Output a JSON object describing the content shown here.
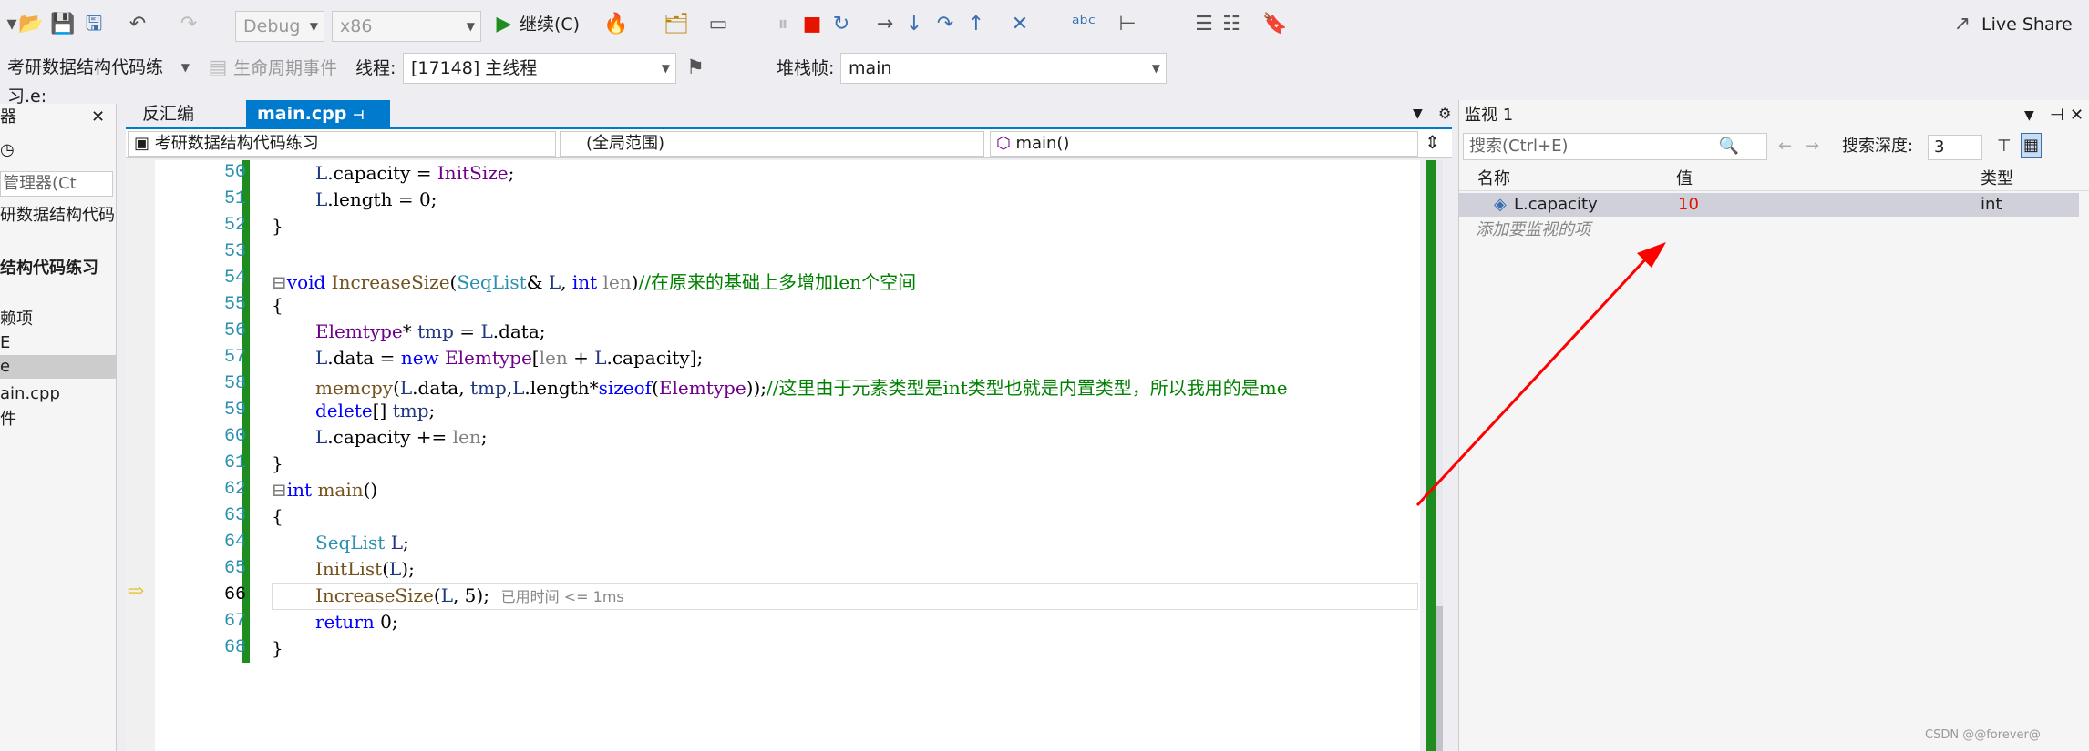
{
  "toolbar": {
    "config": "Debug",
    "platform": "x86",
    "continue": "继续(C)",
    "live_share": "Live Share"
  },
  "toolbar2": {
    "project": "考研数据结构代码练习.e:",
    "lifecycle": "生命周期事件",
    "thread_label": "线程:",
    "thread_value": "[17148] 主线程",
    "stack_label": "堆栈帧:",
    "stack_value": "main"
  },
  "left_panel": {
    "title": "器",
    "search": "管理器(Ct",
    "items": [
      "研数据结构代码练",
      "结构代码练习",
      "赖项",
      "E",
      "e",
      "ain.cpp",
      "件"
    ]
  },
  "tabs": {
    "disasm": "反汇编",
    "main": "main.cpp"
  },
  "navbar": {
    "project": "考研数据结构代码练习",
    "scope": "(全局范围)",
    "func": "main()"
  },
  "code": {
    "lines": [
      50,
      51,
      52,
      53,
      54,
      55,
      56,
      57,
      58,
      59,
      60,
      61,
      62,
      63,
      64,
      65,
      66,
      67,
      68
    ],
    "elapsed": "已用时间 <= 1ms"
  },
  "watch": {
    "title": "监视 1",
    "search": "搜索(Ctrl+E)",
    "depth_label": "搜索深度:",
    "depth_value": "3",
    "col_name": "名称",
    "col_value": "值",
    "col_type": "类型",
    "row": {
      "name": "L.capacity",
      "value": "10",
      "type": "int"
    },
    "add": "添加要监视的项"
  },
  "watermark": "CSDN @@forever@",
  "colors": {
    "accent": "#007acc",
    "value_changed": "#e51400",
    "arrow": "#ff0000"
  }
}
